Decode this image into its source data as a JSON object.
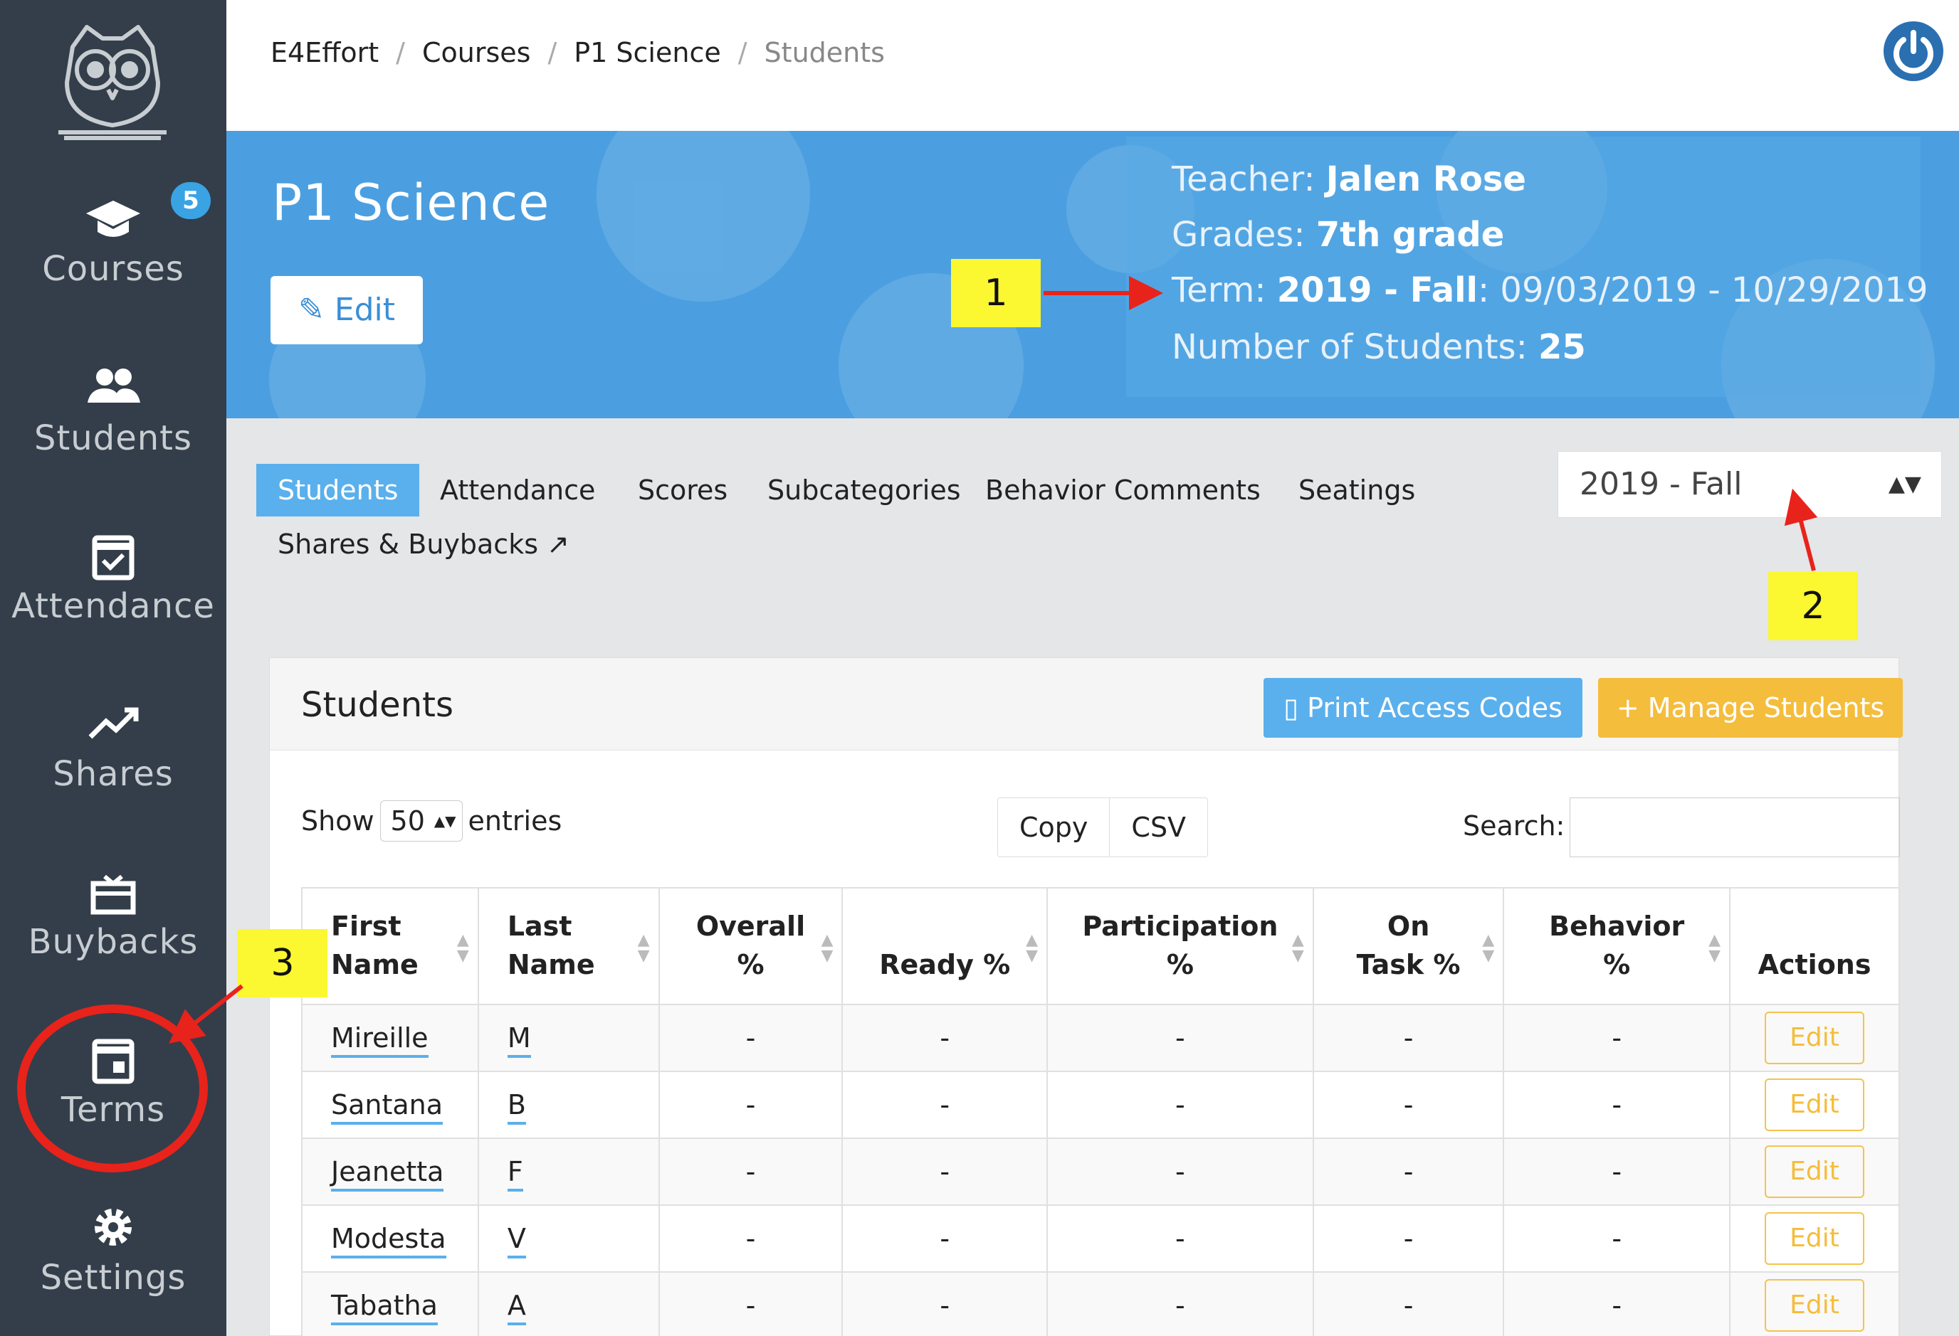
{
  "sidebar": {
    "badge": "5",
    "items": [
      {
        "label": "Courses",
        "icon": "graduation-cap-icon"
      },
      {
        "label": "Students",
        "icon": "users-icon"
      },
      {
        "label": "Attendance",
        "icon": "calendar-check-icon"
      },
      {
        "label": "Shares",
        "icon": "trend-up-icon"
      },
      {
        "label": "Buybacks",
        "icon": "gift-icon"
      },
      {
        "label": "Terms",
        "icon": "calendar-icon"
      },
      {
        "label": "Settings",
        "icon": "gear-icon"
      }
    ]
  },
  "breadcrumb": {
    "items": [
      "E4Effort",
      "Courses",
      "P1 Science"
    ],
    "current": "Students"
  },
  "hero": {
    "title": "P1 Science",
    "edit_label": "Edit",
    "teacher_label": "Teacher: ",
    "teacher": "Jalen Rose",
    "grades_label": "Grades: ",
    "grades": "7th grade",
    "term_label": "Term: ",
    "term": "2019 - Fall",
    "term_dates": ": 09/03/2019 - 10/29/2019",
    "students_label": "Number of Students: ",
    "students_count": "25"
  },
  "tabs": {
    "items": [
      "Students",
      "Attendance",
      "Scores",
      "Subcategories",
      "Behavior Comments",
      "Seatings"
    ],
    "second_row": "Shares & Buybacks",
    "active": "Students"
  },
  "term_select": {
    "value": "2019 - Fall"
  },
  "annotations": [
    "1",
    "2",
    "3"
  ],
  "card": {
    "title": "Students",
    "print_label": "Print Access Codes",
    "manage_label": "Manage Students",
    "show_label": "Show",
    "show_value": "50",
    "entries_label": "entries",
    "copy_label": "Copy",
    "csv_label": "CSV",
    "search_label": "Search:"
  },
  "table": {
    "headers": [
      [
        "First",
        "Name"
      ],
      [
        "Last",
        "Name"
      ],
      [
        "Overall",
        "%"
      ],
      [
        "",
        "Ready %"
      ],
      [
        "Participation",
        "%"
      ],
      [
        "On",
        "Task %"
      ],
      [
        "Behavior",
        "%"
      ],
      [
        "",
        "Actions"
      ]
    ],
    "rows": [
      {
        "first": "Mireille",
        "last": "M",
        "overall": "-",
        "ready": "-",
        "participation": "-",
        "on_task": "-",
        "behavior": "-",
        "action": "Edit"
      },
      {
        "first": "Santana",
        "last": "B",
        "overall": "-",
        "ready": "-",
        "participation": "-",
        "on_task": "-",
        "behavior": "-",
        "action": "Edit"
      },
      {
        "first": "Jeanetta",
        "last": "F",
        "overall": "-",
        "ready": "-",
        "participation": "-",
        "on_task": "-",
        "behavior": "-",
        "action": "Edit"
      },
      {
        "first": "Modesta",
        "last": "V",
        "overall": "-",
        "ready": "-",
        "participation": "-",
        "on_task": "-",
        "behavior": "-",
        "action": "Edit"
      },
      {
        "first": "Tabatha",
        "last": "A",
        "overall": "-",
        "ready": "-",
        "participation": "-",
        "on_task": "-",
        "behavior": "-",
        "action": "Edit"
      }
    ]
  },
  "colors": {
    "sidebar": "#333e4a",
    "accent": "#5ab0ec",
    "warning": "#f5bd3c",
    "annotation": "#fbf730",
    "annotation_arrow": "#e8231b"
  }
}
